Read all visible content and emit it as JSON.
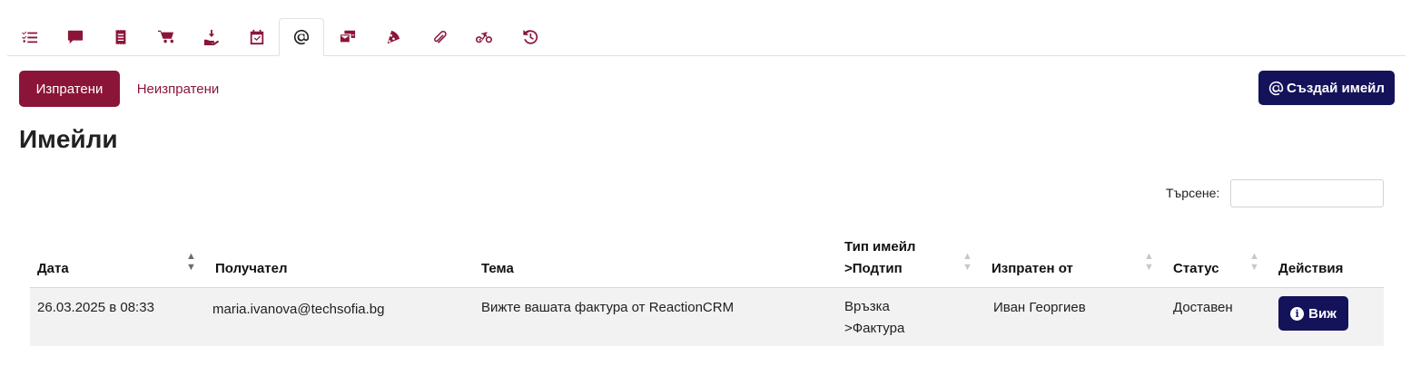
{
  "tabs": [
    {
      "icon": "tasks-icon",
      "active": false
    },
    {
      "icon": "comment-icon",
      "active": false
    },
    {
      "icon": "receipt-icon",
      "active": false
    },
    {
      "icon": "cart-icon",
      "active": false
    },
    {
      "icon": "hand-holding-icon",
      "active": false
    },
    {
      "icon": "calendar-check-icon",
      "active": false
    },
    {
      "icon": "at-icon",
      "active": true
    },
    {
      "icon": "mail-bulk-icon",
      "active": false
    },
    {
      "icon": "pizza-slice-icon",
      "active": false
    },
    {
      "icon": "paperclip-icon",
      "active": false
    },
    {
      "icon": "bicycle-icon",
      "active": false
    },
    {
      "icon": "history-icon",
      "active": false
    }
  ],
  "subtabs": {
    "sent": "Изпратени",
    "unsent": "Неизпратени"
  },
  "create_button": {
    "label": "Създай имейл",
    "icon": "at-icon"
  },
  "page_title": "Имейли",
  "search": {
    "label": "Търсене:",
    "value": "",
    "placeholder": ""
  },
  "table": {
    "headers": {
      "date": "Дата",
      "recipient": "Получател",
      "subject": "Тема",
      "type_line1": "Тип имейл",
      "type_line2": ">Подтип",
      "sent_by": "Изпратен от",
      "status": "Статус",
      "actions": "Действия"
    },
    "rows": [
      {
        "date": "26.03.2025 в 08:33",
        "recipient": "maria.ivanova@techsofia.bg",
        "subject": "Вижте вашата фактура от ReactionCRM",
        "type_line1": "Връзка",
        "type_line2": ">Фактура",
        "sent_by": "Иван Георгиев",
        "status": "Доставен",
        "action_label": "Виж"
      }
    ]
  },
  "colors": {
    "primary": "#8b1538",
    "navy": "#14135a",
    "row_bg": "#f2f2f2"
  }
}
